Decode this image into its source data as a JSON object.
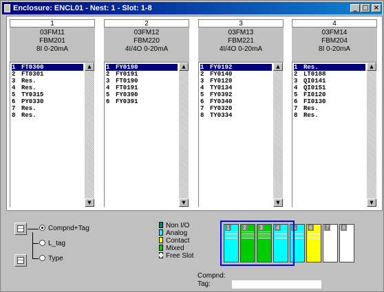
{
  "window": {
    "title": "Enclosure: ENCL01 - Nest: 1 - Slot: 1-8",
    "minimize_glyph": "_",
    "maximize_glyph": "□",
    "close_glyph": "×"
  },
  "modules": [
    {
      "slot": "1",
      "name": "03FM11",
      "type": "FBM201",
      "io": "8I 0-20mA",
      "items": [
        {
          "n": "1",
          "tag": "FT0300",
          "selected": true
        },
        {
          "n": "2",
          "tag": "FT0301"
        },
        {
          "n": "3",
          "tag": "Res."
        },
        {
          "n": "4",
          "tag": "Res."
        },
        {
          "n": "5",
          "tag": "TY0315"
        },
        {
          "n": "6",
          "tag": "PY0330"
        },
        {
          "n": "7",
          "tag": "Res."
        },
        {
          "n": "8",
          "tag": "Res."
        }
      ]
    },
    {
      "slot": "2",
      "name": "03FM12",
      "type": "FBM220",
      "io": "4I/4O 0-20mA",
      "items": [
        {
          "n": "1",
          "tag": "FY0190",
          "selected": true
        },
        {
          "n": "2",
          "tag": "FY0191"
        },
        {
          "n": "3",
          "tag": "FT0190"
        },
        {
          "n": "4",
          "tag": "FT0191"
        },
        {
          "n": "5",
          "tag": "FY0390"
        },
        {
          "n": "6",
          "tag": "FY0391"
        }
      ]
    },
    {
      "slot": "3",
      "name": "03FM13",
      "type": "FBM221",
      "io": "4I/4O 0-20mA",
      "items": [
        {
          "n": "1",
          "tag": "FY0192",
          "selected": true
        },
        {
          "n": "2",
          "tag": "FY0140"
        },
        {
          "n": "3",
          "tag": "FY0120"
        },
        {
          "n": "4",
          "tag": "TY0134"
        },
        {
          "n": "5",
          "tag": "FY0392"
        },
        {
          "n": "6",
          "tag": "FY0340"
        },
        {
          "n": "7",
          "tag": "FY0320"
        },
        {
          "n": "8",
          "tag": "TY0334"
        }
      ]
    },
    {
      "slot": "4",
      "name": "03FM14",
      "type": "FBM204",
      "io": "8I 0-20mA",
      "items": [
        {
          "n": "1",
          "tag": "Res.",
          "selected": true
        },
        {
          "n": "2",
          "tag": "LT0188"
        },
        {
          "n": "3",
          "tag": "QI0141"
        },
        {
          "n": "4",
          "tag": "QI0151"
        },
        {
          "n": "5",
          "tag": "FI0120"
        },
        {
          "n": "6",
          "tag": "FI0130"
        },
        {
          "n": "7",
          "tag": "Res."
        },
        {
          "n": "8",
          "tag": "Res."
        }
      ]
    }
  ],
  "display_options": {
    "compnd_tag": "Compnd+Tag",
    "l_tag": "L_tag",
    "type": "Type",
    "selected": "compnd_tag"
  },
  "legend": [
    {
      "label": "Non I/O",
      "color": "#008080"
    },
    {
      "label": "Analog",
      "color": "#00ffff"
    },
    {
      "label": "Contact",
      "color": "#ffff00"
    },
    {
      "label": "Mixed",
      "color": "#00cc00"
    },
    {
      "label": "Free Slot",
      "color": "#ffffff"
    }
  ],
  "rack": {
    "slots": [
      {
        "num": "1",
        "kind": "Analog",
        "color": "#00ffff"
      },
      {
        "num": "2",
        "kind": "Mixed",
        "color": "#00cc00"
      },
      {
        "num": "3",
        "kind": "Mixed",
        "color": "#00cc00"
      },
      {
        "num": "4",
        "kind": "Analog",
        "color": "#00ffff"
      },
      {
        "num": "5",
        "kind": "Analog",
        "color": "#00ffff"
      },
      {
        "num": "6",
        "kind": "Contact",
        "color": "#ffff00"
      },
      {
        "num": "7",
        "kind": "Free Slot",
        "color": "#ffffff"
      },
      {
        "num": "8",
        "kind": "Free Slot",
        "color": "#ffffff"
      }
    ],
    "highlighted_slots": "1-4"
  },
  "info": {
    "compnd_label": "Compnd:",
    "compnd_value": "",
    "tag_label": "Tag:",
    "tag_value": ""
  }
}
